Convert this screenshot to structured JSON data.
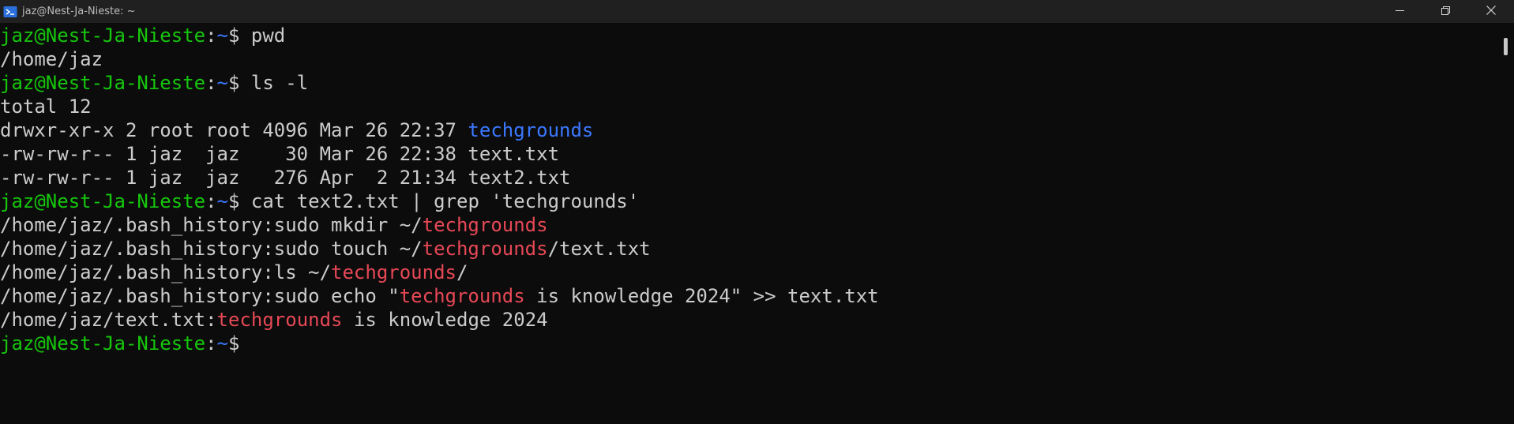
{
  "window": {
    "title": "jaz@Nest-Ja-Nieste: ~",
    "icon": "powershell-terminal-icon"
  },
  "controls": {
    "minimize_icon": "minimize-icon",
    "maximize_icon": "restore-icon",
    "close_icon": "close-icon"
  },
  "prompt": {
    "user_host": "jaz@Nest-Ja-Nieste",
    "colon": ":",
    "path": "~",
    "symbol": "$"
  },
  "commands": {
    "cmd1": " pwd",
    "cmd2": " ls -l",
    "cmd3": " cat text2.txt | grep 'techgrounds'"
  },
  "output": {
    "pwd_result": "/home/jaz",
    "ls_total": "total 12",
    "ls_row1_prefix": "drwxr-xr-x 2 root root 4096 Mar 26 22:37 ",
    "ls_row1_name": "techgrounds",
    "ls_row2": "-rw-rw-r-- 1 jaz  jaz    30 Mar 26 22:38 text.txt",
    "ls_row3": "-rw-rw-r-- 1 jaz  jaz   276 Apr  2 21:34 text2.txt",
    "grep1_a": "/home/jaz/.bash_history:sudo mkdir ~/",
    "grep1_match": "techgrounds",
    "grep2_a": "/home/jaz/.bash_history:sudo touch ~/",
    "grep2_match": "techgrounds",
    "grep2_b": "/text.txt",
    "grep3_a": "/home/jaz/.bash_history:ls ~/",
    "grep3_match": "techgrounds",
    "grep3_b": "/",
    "grep4_a": "/home/jaz/.bash_history:sudo echo \"",
    "grep4_match": "techgrounds",
    "grep4_b": " is knowledge 2024\" >> text.txt",
    "grep5_a": "/home/jaz/text.txt:",
    "grep5_match": "techgrounds",
    "grep5_b": " is knowledge 2024"
  },
  "colors": {
    "background": "#0c0c0c",
    "titlebar": "#202020",
    "prompt_green": "#16c60c",
    "path_blue": "#3b78ff",
    "match_red": "#e74856",
    "text": "#cccccc"
  }
}
